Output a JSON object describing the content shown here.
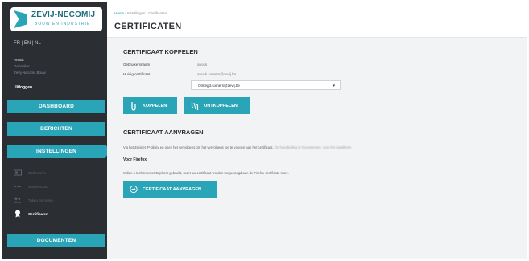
{
  "brand": {
    "name": "ZEVIJ-NECOMIJ",
    "tagline": "Bouw en industrie"
  },
  "sidebar": {
    "lang": "FR | EN | NL",
    "user": {
      "line1": "Anouk",
      "line2": "Gebruiker",
      "line3": "Zevij-Necomij Bouw",
      "logout": "Uitloggen"
    },
    "nav": {
      "dashboard": "DASHBOARD",
      "berichten": "BERICHTEN",
      "instellingen": "INSTELLINGEN",
      "documenten": "DOCUMENTEN"
    },
    "subitems": [
      {
        "label": "Gebruikers",
        "icon": "users-icon"
      },
      {
        "label": "Wachtwoord",
        "icon": "password-icon"
      },
      {
        "label": "Taken en rollen",
        "icon": "roles-icon"
      },
      {
        "label": "Certificaten",
        "icon": "certificate-icon"
      }
    ]
  },
  "header": {
    "breadcrumb_home": "Home",
    "breadcrumb_rest": " / Instellingen / Certificaten",
    "title": "CERTIFICATEN"
  },
  "koppelen": {
    "title": "CERTIFICAAT KOPPELEN",
    "label_user": "Gebruikersnaam",
    "value_user": "anouk",
    "label_cert": "Huidig certificaat",
    "value_cert": "anouk.somers@zevij.be",
    "select_value": "Otmegd.somers@zevij.be",
    "btn_koppelen": "KOPPELEN",
    "btn_ontkoppelen": "ONTKOPPELEN"
  },
  "aanvragen": {
    "title": "CERTIFICAAT AANVRAGEN",
    "paragraph1_a": "Via het Zevinet iP-plicity en open het vervolgens om het vervolgens toe te voegen aan het certificaat.",
    "paragraph1_b": "Zie handleiding in Documenten, voor het installeren.",
    "subhead": "Voor Firefox",
    "paragraph2": "Indien u toch Internet Explorer gebruikt, moet uw certificaat worden toegevoegd aan de Firefox certificate store.",
    "btn_aanvragen": "CERTIFICAAT AANVRAGEN"
  },
  "colors": {
    "accent": "#2aa5b8",
    "sidebar": "#2b2e33",
    "content_bg": "#f2f3f4"
  }
}
